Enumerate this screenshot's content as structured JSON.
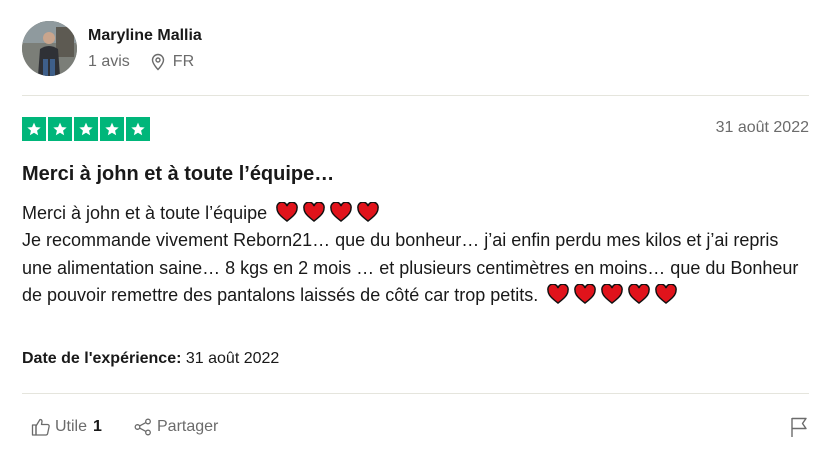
{
  "reviewer": {
    "name": "Maryline Mallia",
    "reviews_count": "1 avis",
    "country": "FR",
    "avatar_icon": "user-photo"
  },
  "review": {
    "rating": 5,
    "rating_color": "#00b67a",
    "date": "31 août 2022",
    "title": "Merci à john et à toute l’équipe…",
    "body_line1": "Merci à john et à toute l’équipe",
    "body_line2": "Je recommande vivement Reborn21… que du bonheur… j’ai enfin perdu mes kilos et j’ai repris une alimentation saine… 8 kgs en 2 mois … et plusieurs centimètres en moins… que du Bonheur de pouvoir remettre des pantalons laissés de côté car trop petits.",
    "experience_label": "Date de l'expérience:",
    "experience_date": "31 août 2022"
  },
  "actions": {
    "useful_label": "Utile",
    "useful_count": "1",
    "share_label": "Partager"
  },
  "colors": {
    "heart": "#e0131b",
    "muted_text": "#6b6b6b"
  }
}
